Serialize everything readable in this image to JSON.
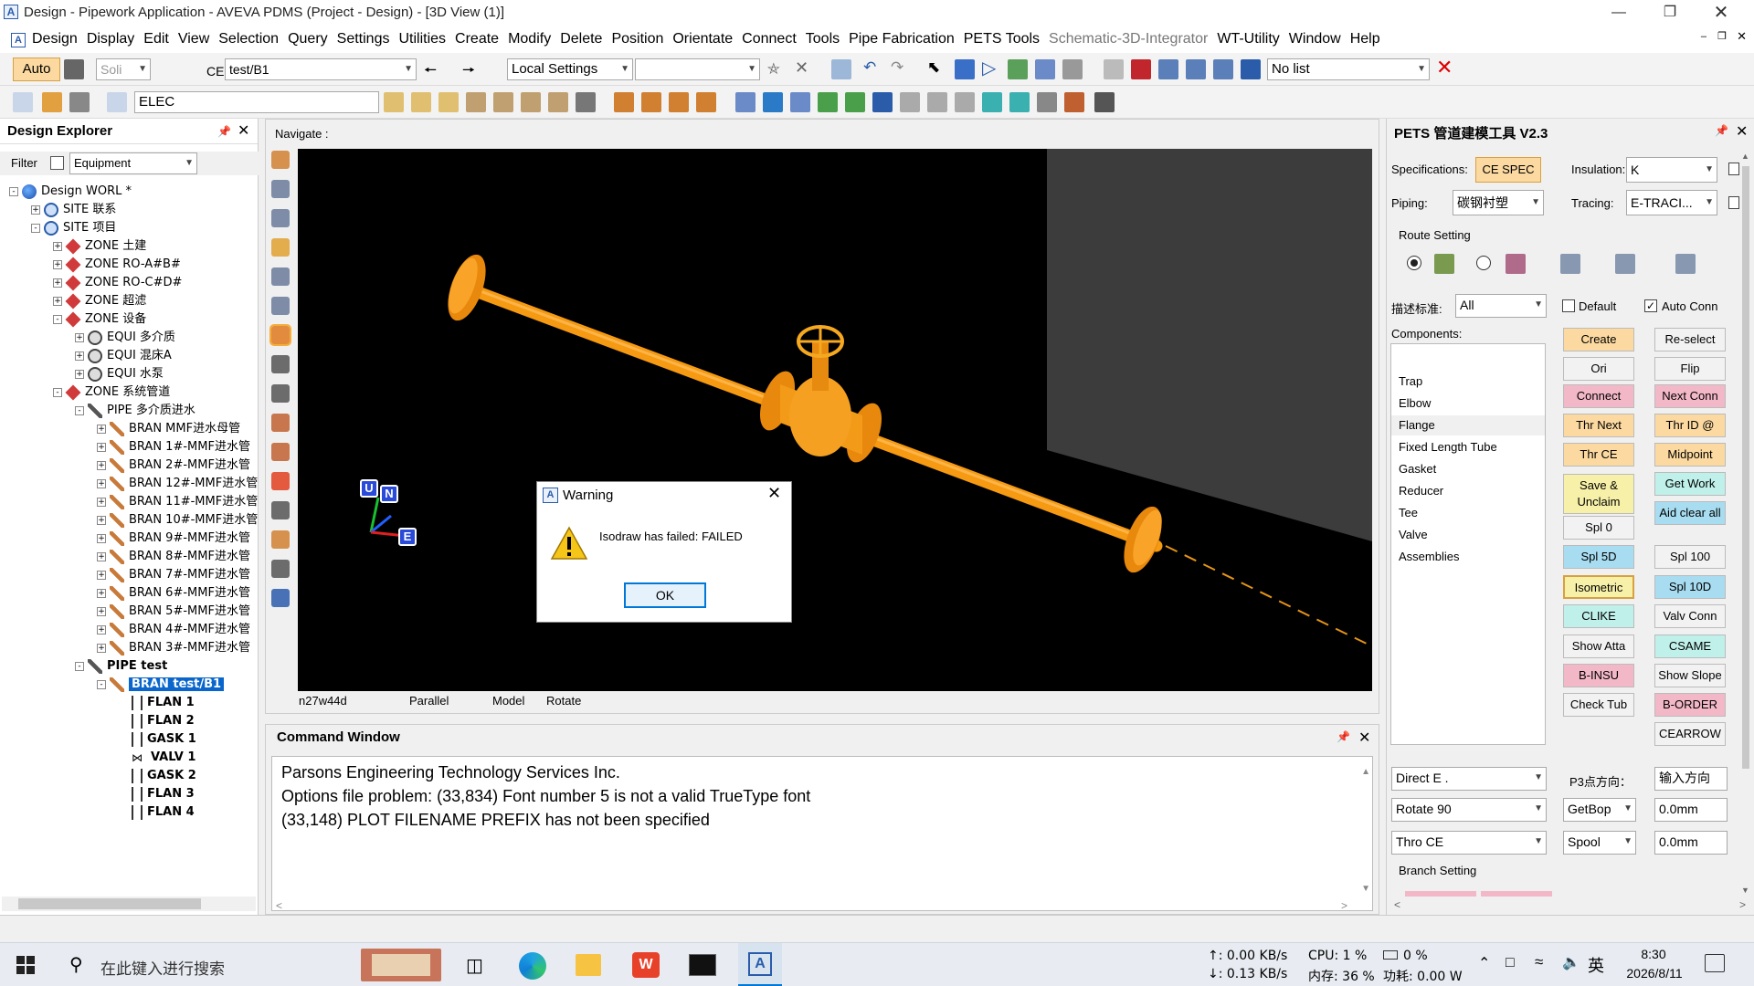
{
  "window": {
    "title": "Design - Pipework Application - AVEVA PDMS (Project - Design) - [3D View (1)]"
  },
  "menu": {
    "items": [
      "Design",
      "Display",
      "Edit",
      "View",
      "Selection",
      "Query",
      "Settings",
      "Utilities",
      "Create",
      "Modify",
      "Delete",
      "Position",
      "Orientate",
      "Connect",
      "Tools",
      "Pipe Fabrication",
      "PETS Tools",
      "Schematic-3D-Integrator",
      "WT-Utility",
      "Window",
      "Help"
    ]
  },
  "toolbar1": {
    "auto_label": "Auto",
    "solid_label": "Soli",
    "ce_label": "CE",
    "ce_value": "test/B1",
    "local_settings": "Local Settings",
    "no_list": "No list"
  },
  "toolbar2": {
    "elec_value": "ELEC"
  },
  "explorer": {
    "title": "Design Explorer",
    "filter_label": "Filter",
    "filter_value": "Equipment",
    "nodes": [
      "Design WORL *",
      "SITE 联系",
      "SITE 项目",
      "ZONE 土建",
      "ZONE RO-A#B#",
      "ZONE RO-C#D#",
      "ZONE 超滤",
      "ZONE 设备",
      "EQUI 多介质",
      "EQUI 混床A",
      "EQUI 水泵",
      "ZONE 系统管道",
      "PIPE 多介质进水",
      "BRAN MMF进水母管",
      "BRAN 1#-MMF进水管",
      "BRAN 2#-MMF进水管",
      "BRAN 12#-MMF进水管",
      "BRAN 11#-MMF进水管",
      "BRAN 10#-MMF进水管",
      "BRAN 9#-MMF进水管",
      "BRAN 8#-MMF进水管",
      "BRAN 7#-MMF进水管",
      "BRAN 6#-MMF进水管",
      "BRAN 5#-MMF进水管",
      "BRAN 4#-MMF进水管",
      "BRAN 3#-MMF进水管",
      "PIPE test",
      "BRAN test/B1",
      "FLAN 1",
      "FLAN 2",
      "GASK 1",
      "VALV 1",
      "GASK 2",
      "FLAN 3",
      "FLAN 4"
    ]
  },
  "view": {
    "navigate": "Navigate :",
    "status": [
      "n27w44d",
      "Parallel",
      "Model",
      "Rotate"
    ],
    "axis": {
      "u": "U",
      "n": "N",
      "e": "E"
    }
  },
  "dialog": {
    "title": "Warning",
    "message": "Isodraw has failed: FAILED",
    "ok": "OK"
  },
  "command": {
    "title": "Command Window",
    "lines": [
      "Parsons Engineering Technology Services Inc.",
      "Options file problem: (33,834)  Font number 5 is not a valid TrueType font",
      "(33,148)  PLOT FILENAME PREFIX has not been specified"
    ]
  },
  "pets": {
    "title": "PETS 管道建模工具 V2.3",
    "spec_label": "Specifications:",
    "spec_value": "CE SPEC",
    "insulation_label": "Insulation:",
    "insulation_value": "K",
    "piping_label": "Piping:",
    "piping_value": "碳钢衬塑",
    "tracing_label": "Tracing:",
    "tracing_value": "E-TRACI...",
    "route_setting": "Route Setting",
    "desc_label": "描述标准:",
    "desc_value": "All",
    "default_label": "Default",
    "autoconn_label": "Auto Conn",
    "components_label": "Components:",
    "components": [
      "Trap",
      "Elbow",
      "Flange",
      "Fixed Length Tube",
      "Gasket",
      "Reducer",
      "Tee",
      "Valve",
      "Assemblies"
    ],
    "buttons_left": [
      "Create",
      "Ori",
      "Connect",
      "Thr Next",
      "Thr CE",
      "Save & Unclaim",
      "Spl 0",
      "Spl 5D",
      "Isometric",
      "CLIKE",
      "Show Atta",
      "B-INSU",
      "Check Tub"
    ],
    "buttons_right": [
      "Re-select",
      "Flip",
      "Next Conn",
      "Thr ID @",
      "Midpoint",
      "Get Work",
      "Aid clear all",
      "Spl 100",
      "Spl 10D",
      "Valv Conn",
      "CSAME",
      "Show Slope",
      "B-ORDER",
      "CEARROW"
    ],
    "direct_value": "Direct E     .",
    "p3_label": "P3点方向：",
    "input_dir": "输入方向",
    "rotate_value": "Rotate 90",
    "getbop_value": "GetBop",
    "mm1": "0.0mm",
    "thro_value": "Thro CE",
    "spool_value": "Spool",
    "mm2": "0.0mm",
    "branch_setting": "Branch Setting"
  },
  "taskbar": {
    "search_placeholder": "在此键入进行搜索",
    "net_up": "↑: 0.00 KB/s",
    "net_down": "↓: 0.13 KB/s",
    "cpu": "CPU: 1 %",
    "mem": "内存: 36 %",
    "pct": "0 %",
    "power": "功耗: 0.00 W",
    "ime": "英",
    "time": "8:30",
    "date": "2026/8/11"
  },
  "colors": {
    "pipe": "#f7a21b",
    "viewport": "#000000",
    "accent": "#0078d7",
    "highlight": "#0a66cc"
  }
}
